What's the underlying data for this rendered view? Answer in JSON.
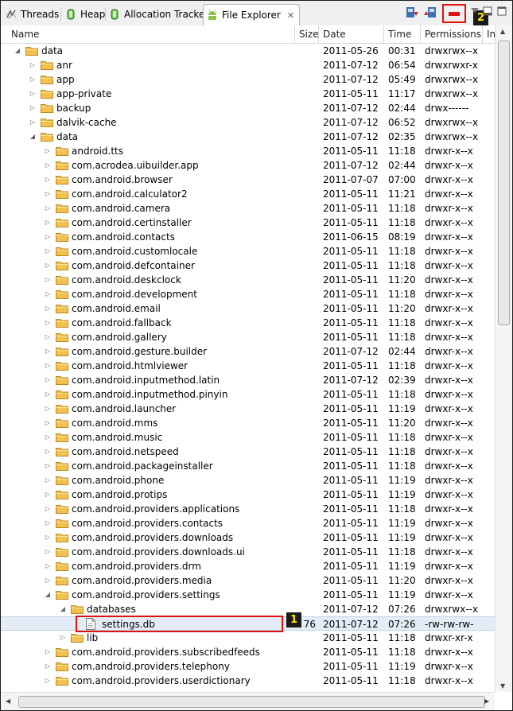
{
  "tabs": [
    {
      "label": "Threads"
    },
    {
      "label": "Heap"
    },
    {
      "label": "Allocation Tracker"
    },
    {
      "label": "File Explorer"
    }
  ],
  "close_glyph": "✕",
  "badges": {
    "first": "1",
    "second": "2"
  },
  "columns": {
    "name": "Name",
    "size": "Size",
    "date": "Date",
    "time": "Time",
    "permissions": "Permissions",
    "info": "In"
  },
  "accent_red": "#e01010",
  "folder_color": "#f2c14e",
  "rows": [
    {
      "depth": 0,
      "exp": "open",
      "type": "folder",
      "name": "data",
      "size": "",
      "date": "2011-05-26",
      "time": "00:31",
      "perm": "drwxrwx--x"
    },
    {
      "depth": 1,
      "exp": "closed",
      "type": "folder",
      "name": "anr",
      "size": "",
      "date": "2011-07-12",
      "time": "06:54",
      "perm": "drwxrwxr-x"
    },
    {
      "depth": 1,
      "exp": "closed",
      "type": "folder",
      "name": "app",
      "size": "",
      "date": "2011-07-12",
      "time": "05:49",
      "perm": "drwxrwx--x"
    },
    {
      "depth": 1,
      "exp": "closed",
      "type": "folder",
      "name": "app-private",
      "size": "",
      "date": "2011-05-11",
      "time": "11:17",
      "perm": "drwxrwx--x"
    },
    {
      "depth": 1,
      "exp": "closed",
      "type": "folder",
      "name": "backup",
      "size": "",
      "date": "2011-07-12",
      "time": "02:44",
      "perm": "drwx------"
    },
    {
      "depth": 1,
      "exp": "closed",
      "type": "folder",
      "name": "dalvik-cache",
      "size": "",
      "date": "2011-07-12",
      "time": "06:52",
      "perm": "drwxrwx--x"
    },
    {
      "depth": 1,
      "exp": "open",
      "type": "folder",
      "name": "data",
      "size": "",
      "date": "2011-07-12",
      "time": "02:35",
      "perm": "drwxrwx--x"
    },
    {
      "depth": 2,
      "exp": "closed",
      "type": "folder",
      "name": "android.tts",
      "size": "",
      "date": "2011-05-11",
      "time": "11:18",
      "perm": "drwxr-x--x"
    },
    {
      "depth": 2,
      "exp": "closed",
      "type": "folder",
      "name": "com.acrodea.uibuilder.app",
      "size": "",
      "date": "2011-07-12",
      "time": "02:44",
      "perm": "drwxr-x--x"
    },
    {
      "depth": 2,
      "exp": "closed",
      "type": "folder",
      "name": "com.android.browser",
      "size": "",
      "date": "2011-07-07",
      "time": "07:00",
      "perm": "drwxr-x--x"
    },
    {
      "depth": 2,
      "exp": "closed",
      "type": "folder",
      "name": "com.android.calculator2",
      "size": "",
      "date": "2011-05-11",
      "time": "11:21",
      "perm": "drwxr-x--x"
    },
    {
      "depth": 2,
      "exp": "closed",
      "type": "folder",
      "name": "com.android.camera",
      "size": "",
      "date": "2011-05-11",
      "time": "11:18",
      "perm": "drwxr-x--x"
    },
    {
      "depth": 2,
      "exp": "closed",
      "type": "folder",
      "name": "com.android.certinstaller",
      "size": "",
      "date": "2011-05-11",
      "time": "11:18",
      "perm": "drwxr-x--x"
    },
    {
      "depth": 2,
      "exp": "closed",
      "type": "folder",
      "name": "com.android.contacts",
      "size": "",
      "date": "2011-06-15",
      "time": "08:19",
      "perm": "drwxr-x--x"
    },
    {
      "depth": 2,
      "exp": "closed",
      "type": "folder",
      "name": "com.android.customlocale",
      "size": "",
      "date": "2011-05-11",
      "time": "11:18",
      "perm": "drwxr-x--x"
    },
    {
      "depth": 2,
      "exp": "closed",
      "type": "folder",
      "name": "com.android.defcontainer",
      "size": "",
      "date": "2011-05-11",
      "time": "11:18",
      "perm": "drwxr-x--x"
    },
    {
      "depth": 2,
      "exp": "closed",
      "type": "folder",
      "name": "com.android.deskclock",
      "size": "",
      "date": "2011-05-11",
      "time": "11:20",
      "perm": "drwxr-x--x"
    },
    {
      "depth": 2,
      "exp": "closed",
      "type": "folder",
      "name": "com.android.development",
      "size": "",
      "date": "2011-05-11",
      "time": "11:18",
      "perm": "drwxr-x--x"
    },
    {
      "depth": 2,
      "exp": "closed",
      "type": "folder",
      "name": "com.android.email",
      "size": "",
      "date": "2011-05-11",
      "time": "11:20",
      "perm": "drwxr-x--x"
    },
    {
      "depth": 2,
      "exp": "closed",
      "type": "folder",
      "name": "com.android.fallback",
      "size": "",
      "date": "2011-05-11",
      "time": "11:18",
      "perm": "drwxr-x--x"
    },
    {
      "depth": 2,
      "exp": "closed",
      "type": "folder",
      "name": "com.android.gallery",
      "size": "",
      "date": "2011-05-11",
      "time": "11:18",
      "perm": "drwxr-x--x"
    },
    {
      "depth": 2,
      "exp": "closed",
      "type": "folder",
      "name": "com.android.gesture.builder",
      "size": "",
      "date": "2011-07-12",
      "time": "02:44",
      "perm": "drwxr-x--x"
    },
    {
      "depth": 2,
      "exp": "closed",
      "type": "folder",
      "name": "com.android.htmlviewer",
      "size": "",
      "date": "2011-05-11",
      "time": "11:18",
      "perm": "drwxr-x--x"
    },
    {
      "depth": 2,
      "exp": "closed",
      "type": "folder",
      "name": "com.android.inputmethod.latin",
      "size": "",
      "date": "2011-07-12",
      "time": "02:39",
      "perm": "drwxr-x--x"
    },
    {
      "depth": 2,
      "exp": "closed",
      "type": "folder",
      "name": "com.android.inputmethod.pinyin",
      "size": "",
      "date": "2011-05-11",
      "time": "11:18",
      "perm": "drwxr-x--x"
    },
    {
      "depth": 2,
      "exp": "closed",
      "type": "folder",
      "name": "com.android.launcher",
      "size": "",
      "date": "2011-05-11",
      "time": "11:19",
      "perm": "drwxr-x--x"
    },
    {
      "depth": 2,
      "exp": "closed",
      "type": "folder",
      "name": "com.android.mms",
      "size": "",
      "date": "2011-05-11",
      "time": "11:20",
      "perm": "drwxr-x--x"
    },
    {
      "depth": 2,
      "exp": "closed",
      "type": "folder",
      "name": "com.android.music",
      "size": "",
      "date": "2011-05-11",
      "time": "11:18",
      "perm": "drwxr-x--x"
    },
    {
      "depth": 2,
      "exp": "closed",
      "type": "folder",
      "name": "com.android.netspeed",
      "size": "",
      "date": "2011-05-11",
      "time": "11:18",
      "perm": "drwxr-x--x"
    },
    {
      "depth": 2,
      "exp": "closed",
      "type": "folder",
      "name": "com.android.packageinstaller",
      "size": "",
      "date": "2011-05-11",
      "time": "11:18",
      "perm": "drwxr-x--x"
    },
    {
      "depth": 2,
      "exp": "closed",
      "type": "folder",
      "name": "com.android.phone",
      "size": "",
      "date": "2011-05-11",
      "time": "11:19",
      "perm": "drwxr-x--x"
    },
    {
      "depth": 2,
      "exp": "closed",
      "type": "folder",
      "name": "com.android.protips",
      "size": "",
      "date": "2011-05-11",
      "time": "11:19",
      "perm": "drwxr-x--x"
    },
    {
      "depth": 2,
      "exp": "closed",
      "type": "folder",
      "name": "com.android.providers.applications",
      "size": "",
      "date": "2011-05-11",
      "time": "11:18",
      "perm": "drwxr-x--x"
    },
    {
      "depth": 2,
      "exp": "closed",
      "type": "folder",
      "name": "com.android.providers.contacts",
      "size": "",
      "date": "2011-05-11",
      "time": "11:19",
      "perm": "drwxr-x--x"
    },
    {
      "depth": 2,
      "exp": "closed",
      "type": "folder",
      "name": "com.android.providers.downloads",
      "size": "",
      "date": "2011-05-11",
      "time": "11:19",
      "perm": "drwxr-x--x"
    },
    {
      "depth": 2,
      "exp": "closed",
      "type": "folder",
      "name": "com.android.providers.downloads.ui",
      "size": "",
      "date": "2011-05-11",
      "time": "11:18",
      "perm": "drwxr-x--x"
    },
    {
      "depth": 2,
      "exp": "closed",
      "type": "folder",
      "name": "com.android.providers.drm",
      "size": "",
      "date": "2011-05-11",
      "time": "11:19",
      "perm": "drwxr-x--x"
    },
    {
      "depth": 2,
      "exp": "closed",
      "type": "folder",
      "name": "com.android.providers.media",
      "size": "",
      "date": "2011-05-11",
      "time": "11:20",
      "perm": "drwxr-x--x"
    },
    {
      "depth": 2,
      "exp": "open",
      "type": "folder",
      "name": "com.android.providers.settings",
      "size": "",
      "date": "2011-05-11",
      "time": "11:19",
      "perm": "drwxr-x--x"
    },
    {
      "depth": 3,
      "exp": "open",
      "type": "folder",
      "name": "databases",
      "size": "",
      "date": "2011-07-12",
      "time": "07:26",
      "perm": "drwxrwx--x"
    },
    {
      "depth": 4,
      "exp": "none",
      "type": "file",
      "name": "settings.db",
      "size": "76",
      "date": "2011-07-12",
      "time": "07:26",
      "perm": "-rw-rw-rw-",
      "selected": true
    },
    {
      "depth": 3,
      "exp": "closed",
      "type": "folder",
      "name": "lib",
      "size": "",
      "date": "2011-05-11",
      "time": "11:18",
      "perm": "drwxr-xr-x"
    },
    {
      "depth": 2,
      "exp": "closed",
      "type": "folder",
      "name": "com.android.providers.subscribedfeeds",
      "size": "",
      "date": "2011-05-11",
      "time": "11:18",
      "perm": "drwxr-x--x"
    },
    {
      "depth": 2,
      "exp": "closed",
      "type": "folder",
      "name": "com.android.providers.telephony",
      "size": "",
      "date": "2011-05-11",
      "time": "11:19",
      "perm": "drwxr-x--x"
    },
    {
      "depth": 2,
      "exp": "closed",
      "type": "folder",
      "name": "com.android.providers.userdictionary",
      "size": "",
      "date": "2011-05-11",
      "time": "11:18",
      "perm": "drwxr-x--x"
    }
  ]
}
